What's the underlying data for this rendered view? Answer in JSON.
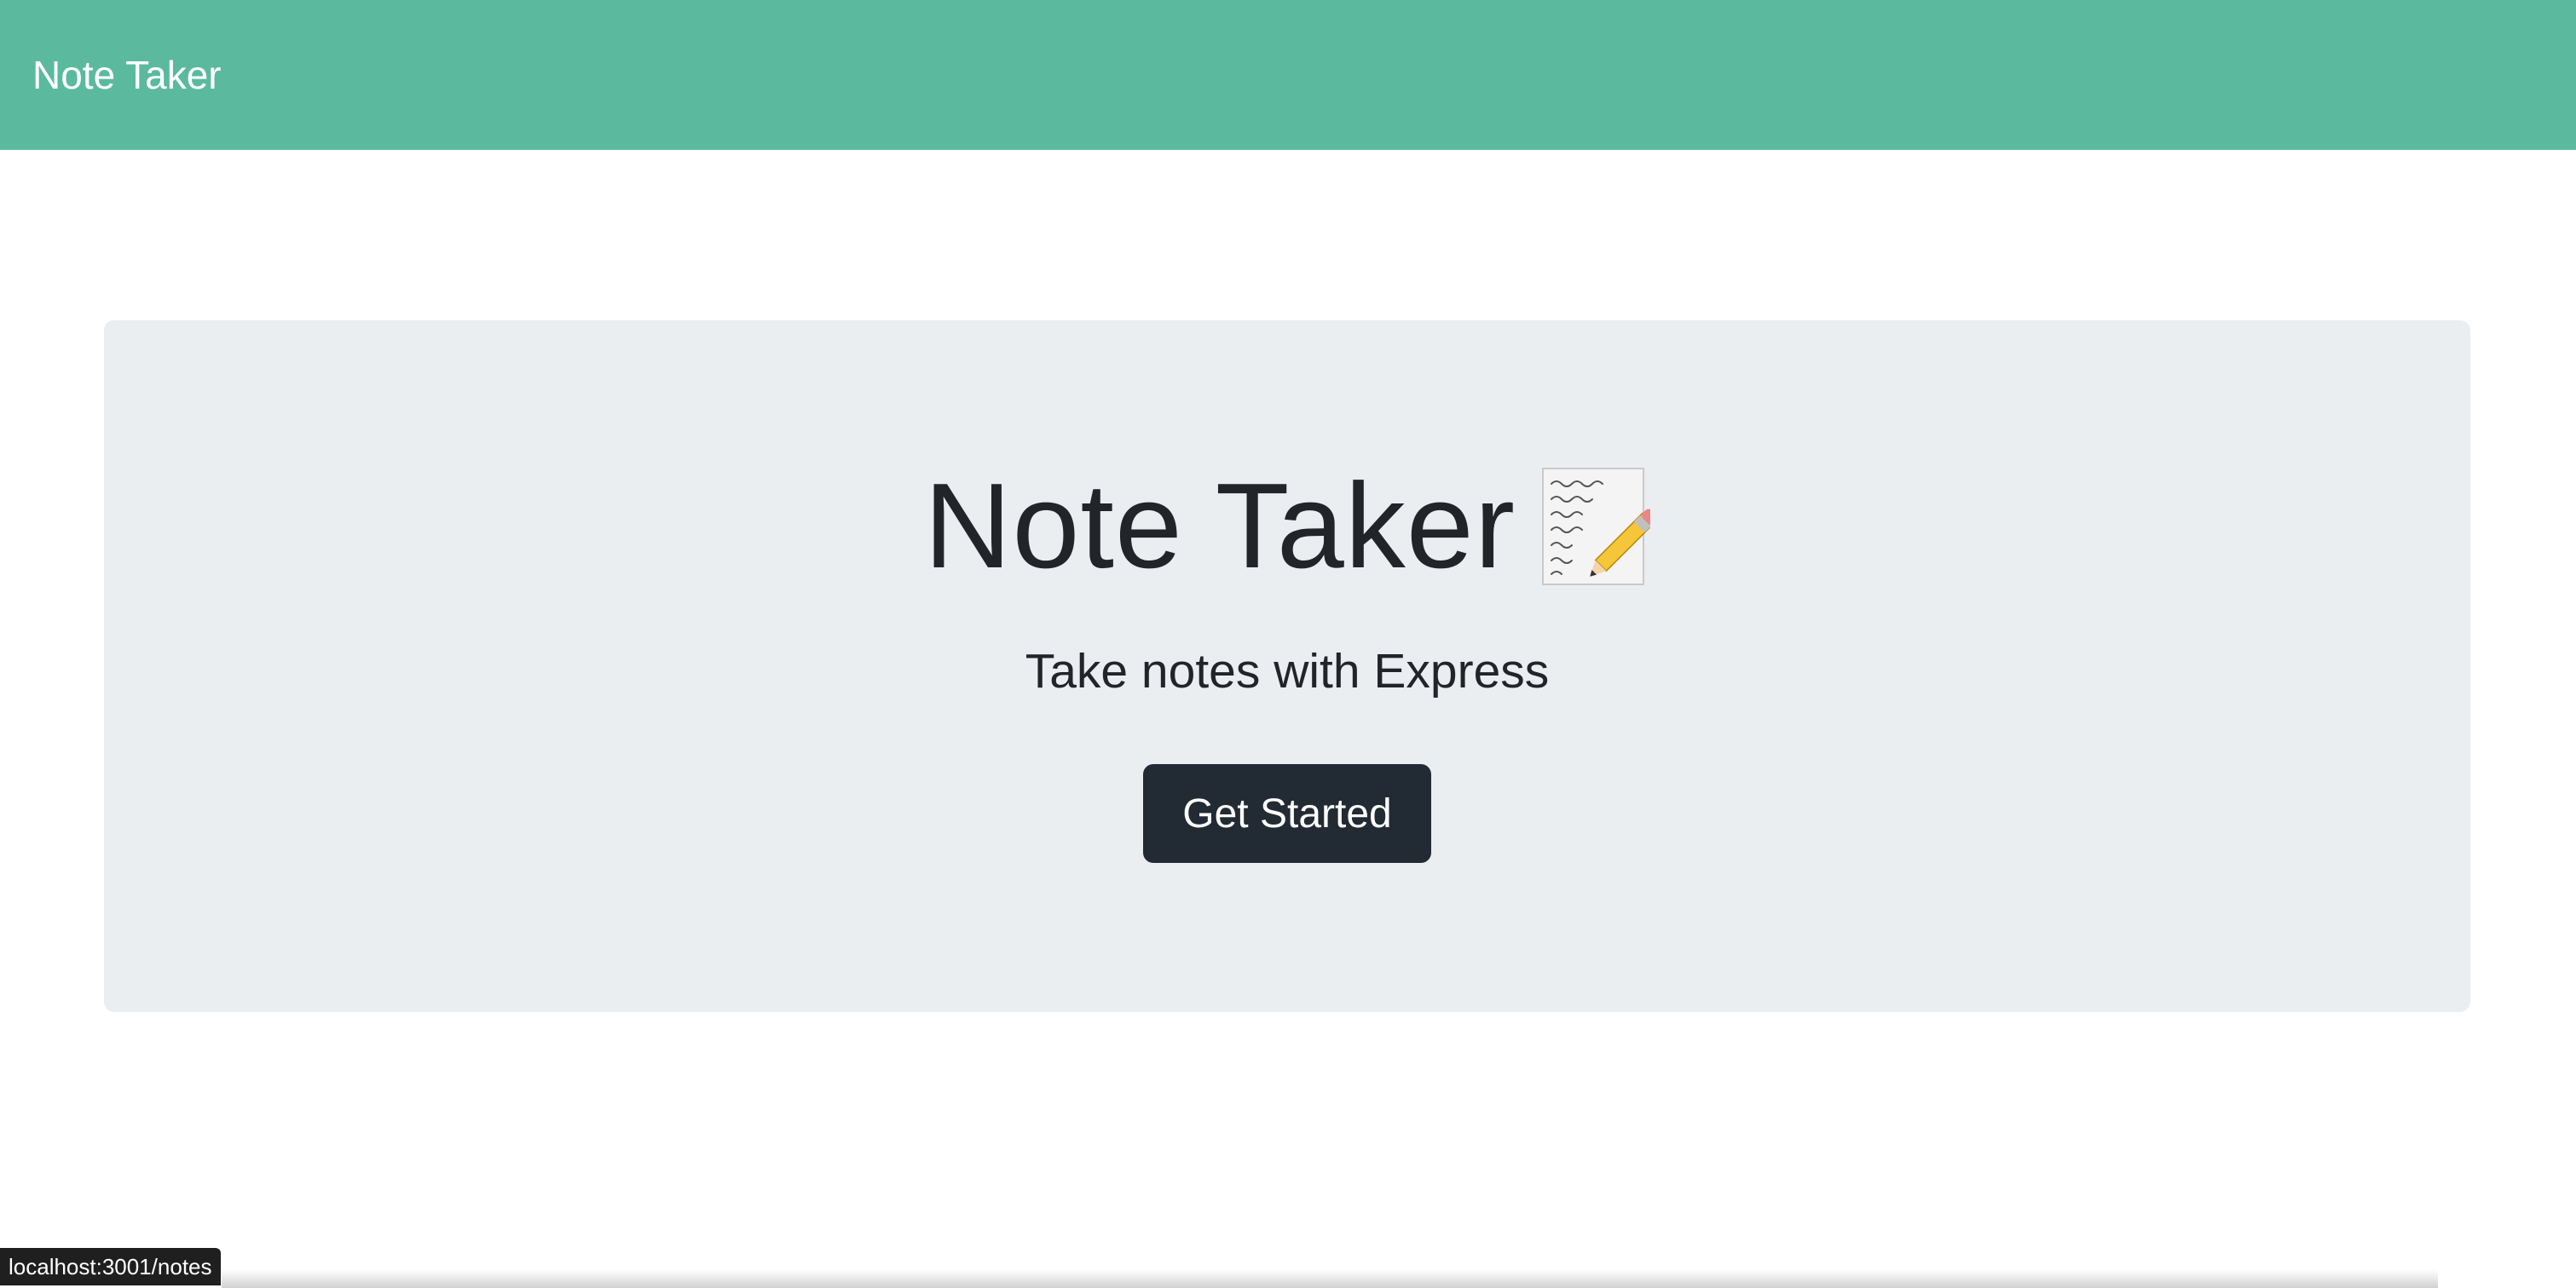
{
  "navbar": {
    "brand": "Note Taker",
    "background_color": "#5bba9e"
  },
  "hero": {
    "title": "Note Taker",
    "title_icon": "memo-icon",
    "subtitle": "Take notes with Express",
    "cta_label": "Get Started",
    "panel_color": "#ebeef0",
    "button_color": "#222a33"
  },
  "status_bar": {
    "url": "localhost:3001/notes"
  }
}
